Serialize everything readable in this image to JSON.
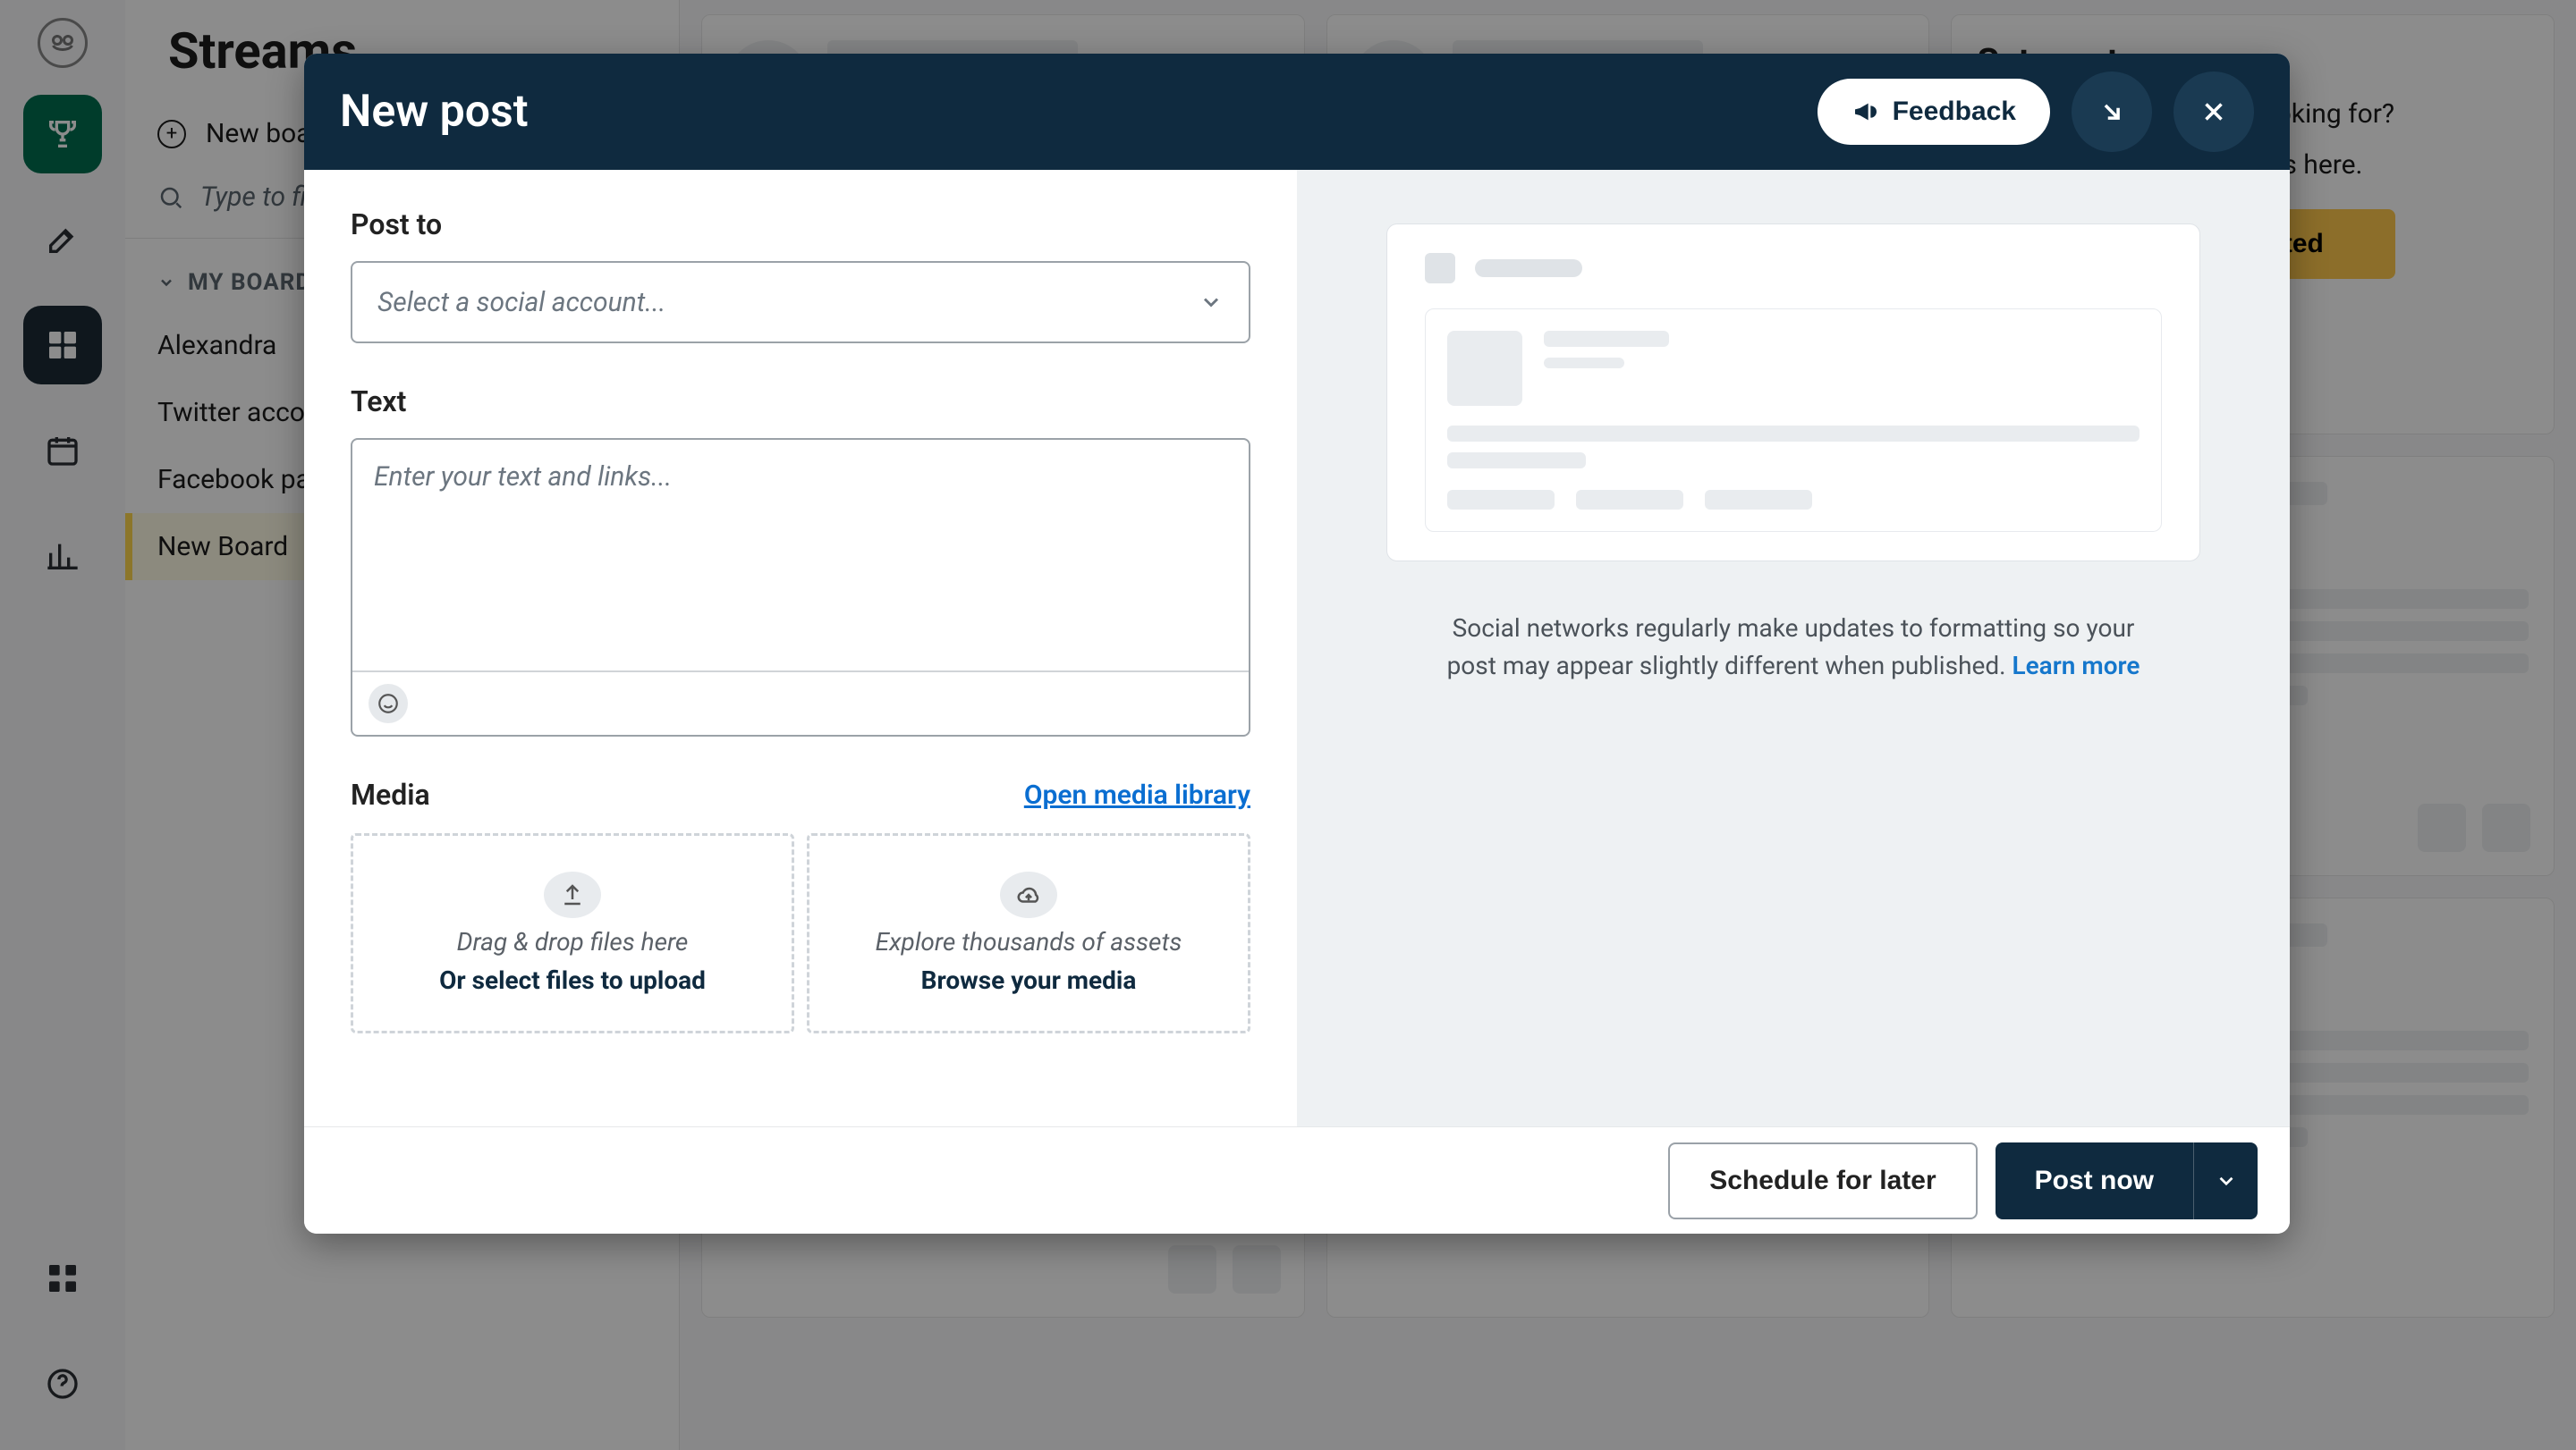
{
  "left_rail": {
    "logo_alt": "owl-logo"
  },
  "sidebar": {
    "title": "Streams",
    "new_board": "New board",
    "search_placeholder": "Type to filter...",
    "section": "MY BOARDS",
    "boards": [
      {
        "label": "Alexandra"
      },
      {
        "label": "Twitter account"
      },
      {
        "label": "Facebook page"
      },
      {
        "label": "New Board"
      }
    ],
    "active_index": 3
  },
  "onboard": {
    "title": "Set up streams",
    "line1": "Not seeing what you're looking for?",
    "line2": "Add streams and networks here.",
    "cta": "Get started"
  },
  "modal": {
    "title": "New post",
    "feedback": "Feedback",
    "form": {
      "post_to_label": "Post to",
      "post_to_placeholder": "Select a social account...",
      "text_label": "Text",
      "text_placeholder": "Enter your text and links...",
      "media_label": "Media",
      "open_media_library": "Open media library",
      "dz_upload_hint": "Drag & drop files here",
      "dz_upload_action": "Or select files to upload",
      "dz_browse_hint": "Explore thousands of assets",
      "dz_browse_action": "Browse your media"
    },
    "preview_note_pre": "Social networks regularly make updates to formatting so your post may appear slightly different when published. ",
    "preview_note_link": "Learn more",
    "footer": {
      "schedule": "Schedule for later",
      "post_now": "Post now"
    }
  }
}
